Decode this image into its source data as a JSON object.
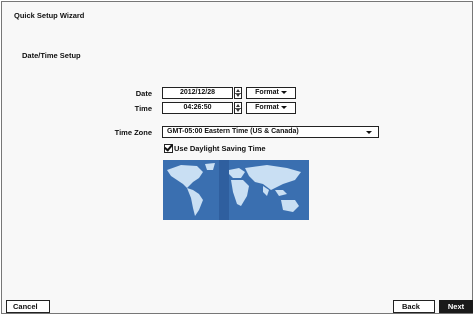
{
  "window": {
    "title": "Quick Setup Wizard"
  },
  "section": {
    "title": "Date/Time Setup"
  },
  "date": {
    "label": "Date",
    "value": "2012/12/28",
    "format_label": "Format"
  },
  "time": {
    "label": "Time",
    "value": "04:26:50",
    "format_label": "Format"
  },
  "timezone": {
    "label": "Time Zone",
    "value": "GMT-05:00 Eastern Time (US & Canada)"
  },
  "dst": {
    "label": "Use Daylight Saving Time",
    "checked": true
  },
  "map": {
    "icon": "world-map-icon",
    "ocean_color": "#3a6fb0",
    "land_color": "#c9dff3"
  },
  "buttons": {
    "cancel": "Cancel",
    "back": "Back",
    "next": "Next"
  }
}
